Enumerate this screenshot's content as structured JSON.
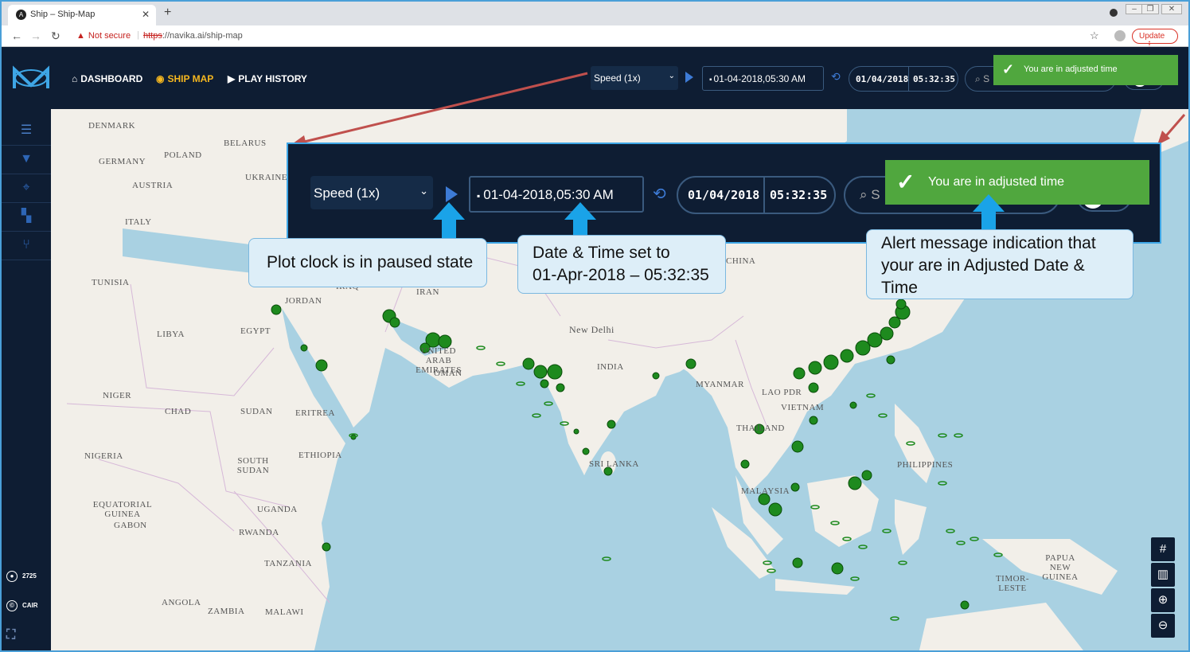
{
  "browser": {
    "tab_title": "Ship – Ship-Map",
    "not_secure": "Not secure",
    "url_scheme": "https",
    "url_rest": "://navika.ai/ship-map",
    "update_label": "Update"
  },
  "header": {
    "nav": [
      {
        "label": "DASHBOARD",
        "icon": "home-icon"
      },
      {
        "label": "SHIP MAP",
        "icon": "target-icon"
      },
      {
        "label": "PLAY HISTORY",
        "icon": "play-circle-icon"
      }
    ],
    "speed": "Speed (1x)",
    "date_value": "01-04-2018,05:30 AM",
    "clock_date": "01/04/2018",
    "clock_time": "05:32:35",
    "search_placeholder": "S",
    "toast": "You are in adjusted time"
  },
  "sidebar": {
    "count_value": "2725",
    "brand_value": "CAIR"
  },
  "map_labels": [
    {
      "text": "DENMARK"
    },
    {
      "text": "BELARUS"
    },
    {
      "text": "POLAND"
    },
    {
      "text": "GERMANY"
    },
    {
      "text": "UKRAINE"
    },
    {
      "text": "AUSTRIA"
    },
    {
      "text": "ITALY"
    },
    {
      "text": "TUNISIA"
    },
    {
      "text": "LIBYA"
    },
    {
      "text": "EGYPT"
    },
    {
      "text": "JORDAN"
    },
    {
      "text": "IRAQ"
    },
    {
      "text": "IRAN"
    },
    {
      "text": "UNITED ARAB EMIRATES"
    },
    {
      "text": "OMAN"
    },
    {
      "text": "New Delhi"
    },
    {
      "text": "INDIA"
    },
    {
      "text": "CHINA"
    },
    {
      "text": "MYANMAR"
    },
    {
      "text": "LAO PDR"
    },
    {
      "text": "VIETNAM"
    },
    {
      "text": "THAILAND"
    },
    {
      "text": "PHILIPPINES"
    },
    {
      "text": "MALAYSIA"
    },
    {
      "text": "SRI LANKA"
    },
    {
      "text": "NIGER"
    },
    {
      "text": "CHAD"
    },
    {
      "text": "SUDAN"
    },
    {
      "text": "ERITREA"
    },
    {
      "text": "NIGERIA"
    },
    {
      "text": "SOUTH SUDAN"
    },
    {
      "text": "ETHIOPIA"
    },
    {
      "text": "EQUATORIAL GUINEA"
    },
    {
      "text": "GABON"
    },
    {
      "text": "UGANDA"
    },
    {
      "text": "RWANDA"
    },
    {
      "text": "TANZANIA"
    },
    {
      "text": "ANGOLA"
    },
    {
      "text": "ZAMBIA"
    },
    {
      "text": "MALAWI"
    },
    {
      "text": "PAPUA NEW GUINEA"
    },
    {
      "text": "TIMOR-LESTE"
    }
  ],
  "annotations": {
    "paused": "Plot clock is in paused state",
    "datetime_line1": "Date & Time set to",
    "datetime_line2": "01-Apr-2018 – 05:32:35",
    "alert_line1": "Alert message indication  that",
    "alert_line2": "your are in  Adjusted Date &",
    "alert_line3": "Time"
  },
  "colors": {
    "header_bg": "#0e1d33",
    "accent_gold": "#f5b71f",
    "accent_blue": "#3d7bd6",
    "toast_green": "#50a73e",
    "ship_green": "#1e8a1e",
    "sea": "#a9d1e2",
    "land": "#f2efe9"
  }
}
